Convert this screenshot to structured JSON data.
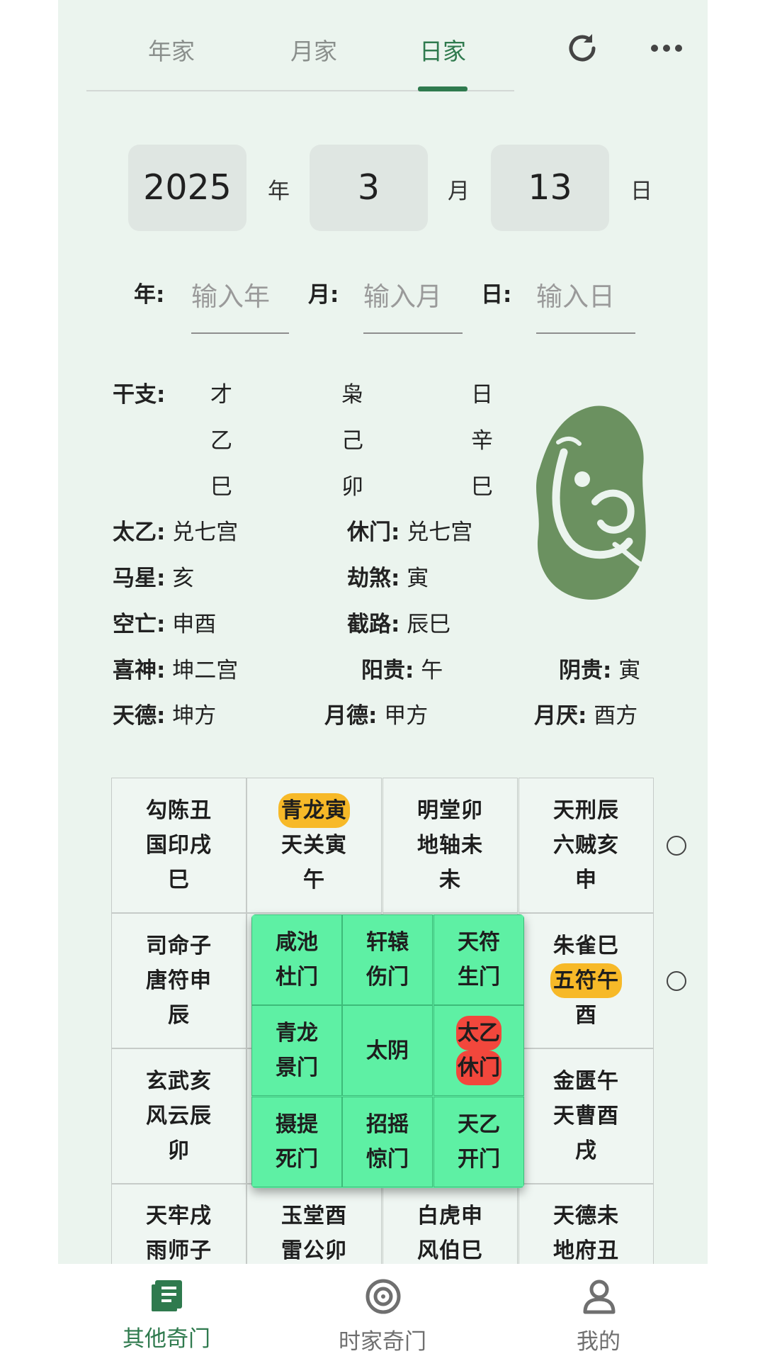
{
  "colors": {
    "accent": "#2f7a4e",
    "app_bg": "#ebf4ee",
    "inner_grid": "#5ef0a4",
    "highlight_yellow": "#f7b928",
    "highlight_red": "#f2473c"
  },
  "tabs": [
    {
      "label": "年家",
      "icon": ""
    },
    {
      "label": "月家",
      "icon": ""
    },
    {
      "label": "日家",
      "icon": ""
    }
  ],
  "toolbar": {
    "refresh_icon": "refresh-icon",
    "more_icon": "more-icon"
  },
  "date": {
    "year": "2025",
    "year_unit": "年",
    "month": "3",
    "month_unit": "月",
    "day": "13",
    "day_unit": "日"
  },
  "inputs": {
    "year_label": "年:",
    "year_placeholder": "输入年",
    "month_label": "月:",
    "month_placeholder": "输入月",
    "day_label": "日:",
    "day_placeholder": "输入日"
  },
  "ganzhi": {
    "label": "干支:",
    "col1": [
      "才",
      "乙",
      "巳"
    ],
    "col2": [
      "枭",
      "己",
      "卯"
    ],
    "col3": [
      "日",
      "辛",
      "巳"
    ]
  },
  "info": {
    "taiyi_label": "太乙:",
    "taiyi": "兑七宫",
    "xiumen_label": "休门:",
    "xiumen": "兑七宫",
    "maxing_label": "马星:",
    "maxing": "亥",
    "jiesha_label": "劫煞:",
    "jiesha": "寅",
    "kongwang_label": "空亡:",
    "kongwang": "申酉",
    "jielu_label": "截路:",
    "jielu": "辰巳",
    "xishen_label": "喜神:",
    "xishen": "坤二宫",
    "yanggui_label": "阳贵:",
    "yanggui": "午",
    "yingui_label": "阴贵:",
    "yingui": "寅",
    "tiande_label": "天德:",
    "tiande": "坤方",
    "yuede_label": "月德:",
    "yuede": "甲方",
    "yueyan_label": "月厌:",
    "yueyan": "酉方"
  },
  "grid": {
    "row1": [
      [
        "勾陈丑",
        "国印戌",
        "巳"
      ],
      [
        "青龙寅",
        "天关寅",
        "午"
      ],
      [
        "明堂卯",
        "地轴未",
        "未"
      ],
      [
        "天刑辰",
        "六贼亥",
        "申"
      ]
    ],
    "row2": [
      [
        "司命子",
        "唐符申",
        "辰"
      ],
      [
        "朱雀巳",
        "五符午",
        "酉"
      ]
    ],
    "row3": [
      [
        "玄武亥",
        "风云辰",
        "卯"
      ],
      [
        "金匮午",
        "天曹酉",
        "戌"
      ]
    ],
    "row4": [
      [
        "天牢戌",
        "雨师子"
      ],
      [
        "玉堂酉",
        "雷公卯"
      ],
      [
        "白虎申",
        "风伯巳"
      ],
      [
        "天德未",
        "地府丑"
      ]
    ],
    "inner": [
      [
        "咸池",
        "杜门"
      ],
      [
        "轩辕",
        "伤门"
      ],
      [
        "天符",
        "生门"
      ],
      [
        "青龙",
        "景门"
      ],
      [
        "太阴"
      ],
      [
        "太乙",
        "休门"
      ],
      [
        "摄提",
        "死门"
      ],
      [
        "招摇",
        "惊门"
      ],
      [
        "天乙",
        "开门"
      ]
    ]
  },
  "bottom_nav": [
    {
      "label": "其他奇门",
      "icon": "book-icon"
    },
    {
      "label": "时家奇门",
      "icon": "target-icon"
    },
    {
      "label": "我的",
      "icon": "person-icon"
    }
  ]
}
